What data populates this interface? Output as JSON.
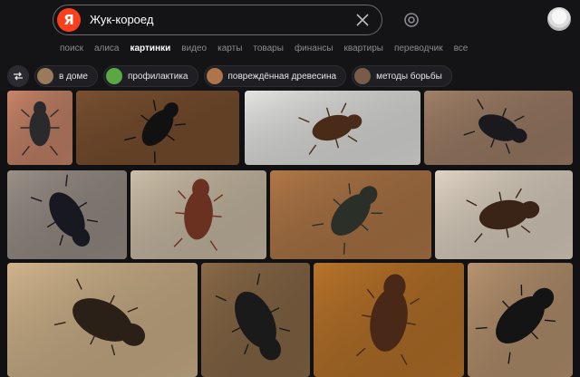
{
  "search": {
    "logo": "Я",
    "query": "Жук-короед"
  },
  "nav": {
    "tabs": [
      {
        "label": "поиск",
        "active": false
      },
      {
        "label": "алиса",
        "active": false
      },
      {
        "label": "картинки",
        "active": true
      },
      {
        "label": "видео",
        "active": false
      },
      {
        "label": "карты",
        "active": false
      },
      {
        "label": "товары",
        "active": false
      },
      {
        "label": "финансы",
        "active": false
      },
      {
        "label": "квартиры",
        "active": false
      },
      {
        "label": "переводчик",
        "active": false
      },
      {
        "label": "все",
        "active": false
      }
    ]
  },
  "filters": {
    "chips": [
      {
        "label": "в доме",
        "color": "#9a7a5a"
      },
      {
        "label": "профилактика",
        "color": "#5aa844"
      },
      {
        "label": "повреждённая древесина",
        "color": "#b0744a"
      },
      {
        "label": "методы борьбы",
        "color": "#7a5a48"
      }
    ]
  },
  "colors": {
    "brand": "#fc3f1d",
    "background": "#111114",
    "active_tab": "#ffffff",
    "inactive_tab": "#8a8a92"
  },
  "results": {
    "images": [
      {
        "id": "r1",
        "bg": "#c9866a",
        "bug": "#2a2a2c"
      },
      {
        "id": "r2",
        "bg": "#7a5030",
        "bug": "#111111"
      },
      {
        "id": "r3",
        "bg": "#e4e4e2",
        "bug": "#4a2a18"
      },
      {
        "id": "r4",
        "bg": "#a08068",
        "bug": "#1a1a1e"
      },
      {
        "id": "r5",
        "bg": "#9a9088",
        "bug": "#181820"
      },
      {
        "id": "r6",
        "bg": "#cdbfa8",
        "bug": "#6a3020"
      },
      {
        "id": "r7",
        "bg": "#b07848",
        "bug": "#2a3028"
      },
      {
        "id": "r8",
        "bg": "#e0d4c4",
        "bug": "#3a2418"
      },
      {
        "id": "r9",
        "bg": "#d0b48c",
        "bug": "#2a2018"
      },
      {
        "id": "r10",
        "bg": "#8a6a48",
        "bug": "#1a1a1a"
      },
      {
        "id": "r11",
        "bg": "#b8742a",
        "bug": "#4a2818"
      },
      {
        "id": "r12",
        "bg": "#b89470",
        "bug": "#141414"
      }
    ]
  }
}
